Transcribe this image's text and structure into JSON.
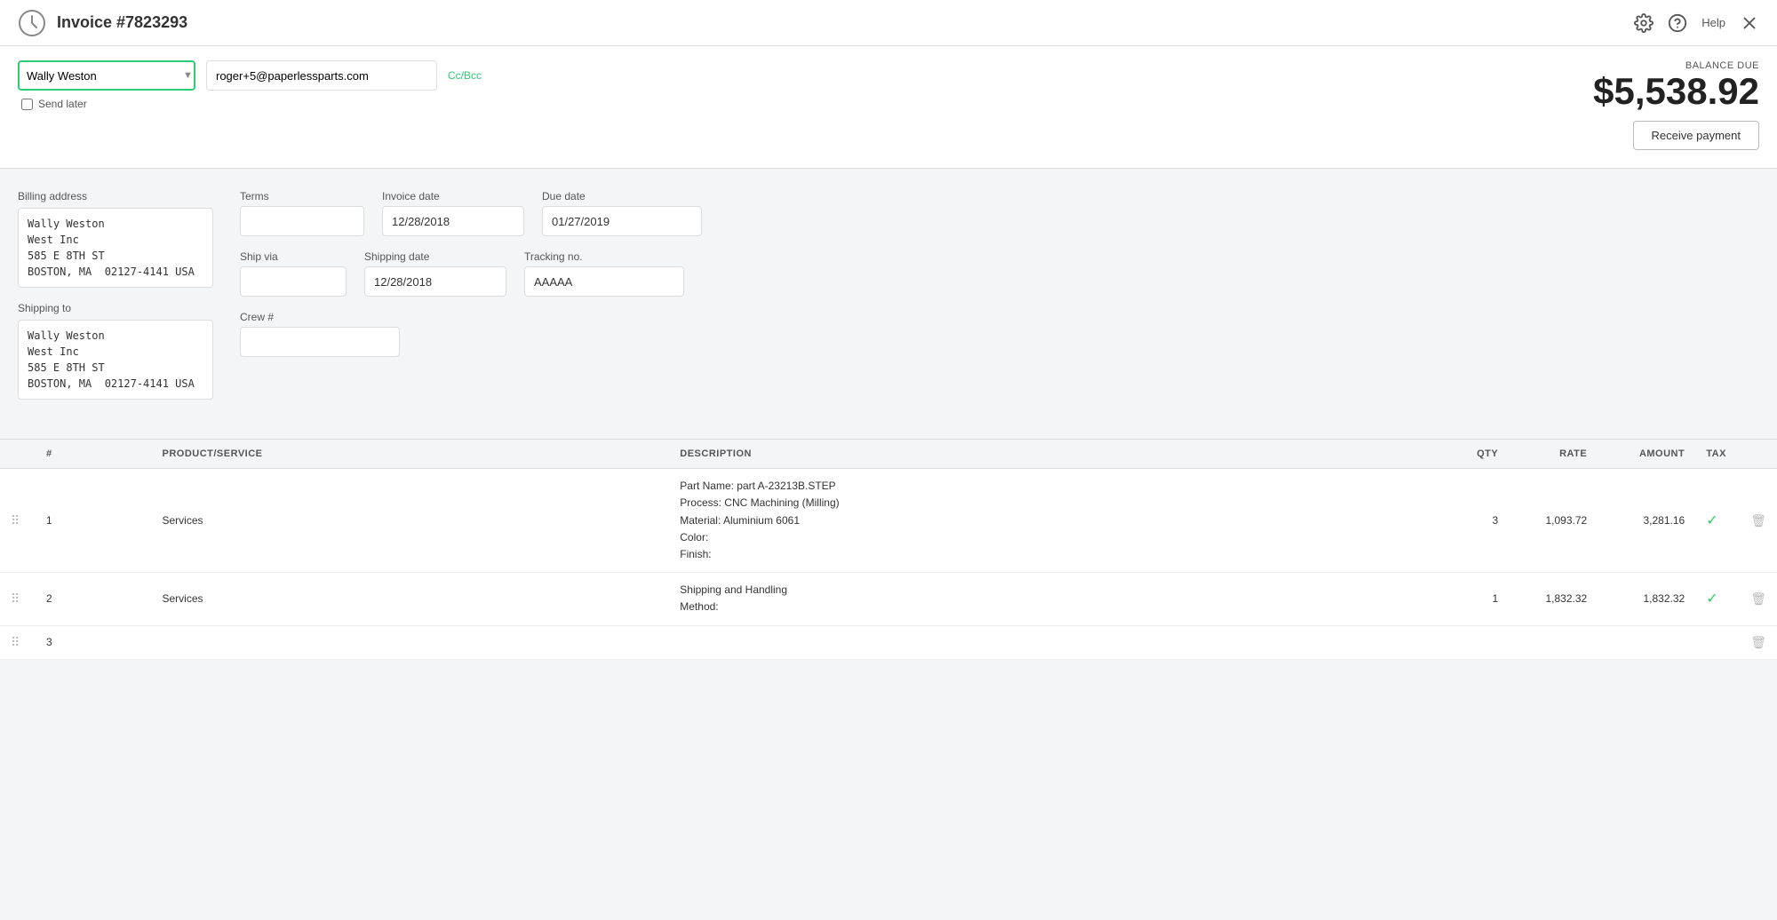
{
  "header": {
    "title": "Invoice  #7823293",
    "help_label": "Help"
  },
  "top_form": {
    "customer_name": "Wally Weston",
    "email": "roger+5@paperlessparts.com",
    "send_later_label": "Send later",
    "cc_bcc_label": "Cc/Bcc"
  },
  "balance": {
    "label": "BALANCE DUE",
    "amount": "$5,538.92",
    "receive_payment_label": "Receive payment"
  },
  "billing": {
    "billing_address_label": "Billing address",
    "billing_address_value": "Wally Weston\nWest Inc\n585 E 8TH ST\nBOSTON, MA  02127-4141 USA",
    "shipping_to_label": "Shipping to",
    "shipping_to_value": "Wally Weston\nWest Inc\n585 E 8TH ST\nBOSTON, MA  02127-4141 USA"
  },
  "fields": {
    "terms_label": "Terms",
    "terms_value": "",
    "invoice_date_label": "Invoice date",
    "invoice_date_value": "12/28/2018",
    "due_date_label": "Due date",
    "due_date_value": "01/27/2019",
    "ship_via_label": "Ship via",
    "ship_via_value": "",
    "shipping_date_label": "Shipping date",
    "shipping_date_value": "12/28/2018",
    "tracking_no_label": "Tracking no.",
    "tracking_no_value": "AAAAA",
    "crew_label": "Crew #",
    "crew_value": ""
  },
  "table": {
    "columns": [
      "#",
      "PRODUCT/SERVICE",
      "DESCRIPTION",
      "QTY",
      "RATE",
      "AMOUNT",
      "TAX"
    ],
    "rows": [
      {
        "num": "1",
        "product": "Services",
        "description": "Part Name: part A-23213B.STEP\nProcess: CNC Machining (Milling)\nMaterial: Aluminium 6061\nColor:\nFinish:",
        "qty": "3",
        "rate": "1,093.72",
        "amount": "3,281.16",
        "tax": true
      },
      {
        "num": "2",
        "product": "Services",
        "description": "Shipping and Handling\nMethod:",
        "qty": "1",
        "rate": "1,832.32",
        "amount": "1,832.32",
        "tax": true
      },
      {
        "num": "3",
        "product": "",
        "description": "",
        "qty": "",
        "rate": "",
        "amount": "",
        "tax": false
      }
    ]
  }
}
